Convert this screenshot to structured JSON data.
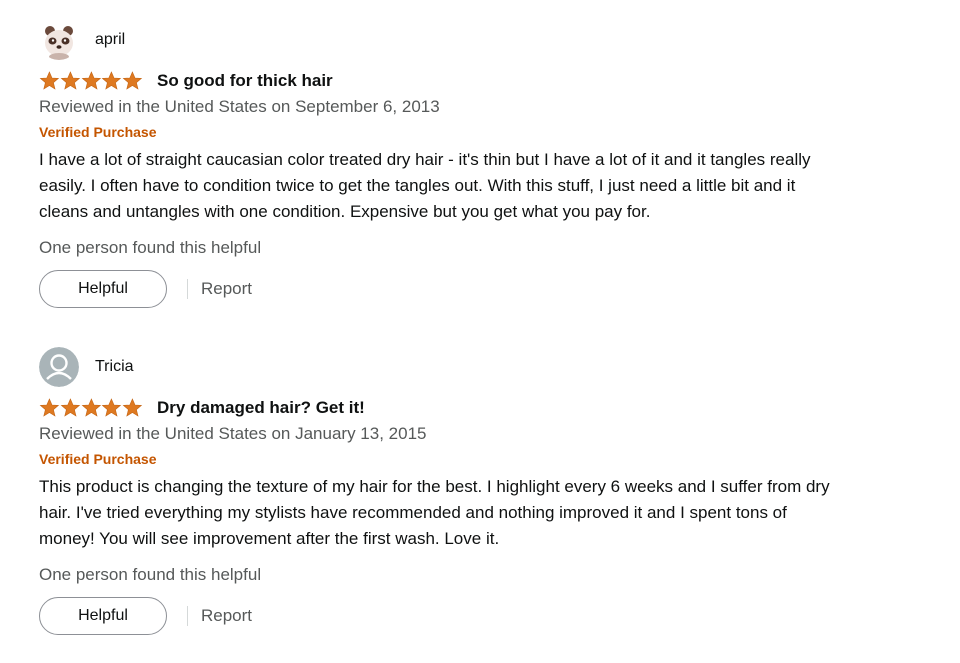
{
  "colors": {
    "star": "#de7921",
    "verified": "#c45500",
    "secondary_text": "#565959",
    "primary_text": "#0f1111"
  },
  "reviews": [
    {
      "profile_name": "april",
      "avatar_icon": "panda-bear-avatar-icon",
      "rating": 5,
      "max_rating": 5,
      "title": "So good for thick hair",
      "date": "Reviewed in the United States on September 6, 2013",
      "verified": "Verified Purchase",
      "body": [
        "I have a lot of straight caucasian color treated dry hair - it's thin but I have a lot of it and it tangles really",
        "easily. I often have to condition twice to get the tangles out. With this stuff, I just need a little bit and it",
        "cleans and untangles with one condition. Expensive but you get what you pay for."
      ],
      "helpful_count": "One person found this helpful",
      "helpful_label": "Helpful",
      "report_label": "Report"
    },
    {
      "profile_name": "Tricia",
      "avatar_icon": "default-user-avatar-icon",
      "rating": 5,
      "max_rating": 5,
      "title": "Dry damaged hair? Get it!",
      "date": "Reviewed in the United States on January 13, 2015",
      "verified": "Verified Purchase",
      "body": [
        "This product is changing the texture of my hair for the best. I highlight every 6 weeks and I suffer from dry",
        "hair. I've tried everything my stylists have recommended and nothing improved it and I spent tons of",
        "money! You will see improvement after the first wash. Love it."
      ],
      "helpful_count": "One person found this helpful",
      "helpful_label": "Helpful",
      "report_label": "Report"
    }
  ]
}
